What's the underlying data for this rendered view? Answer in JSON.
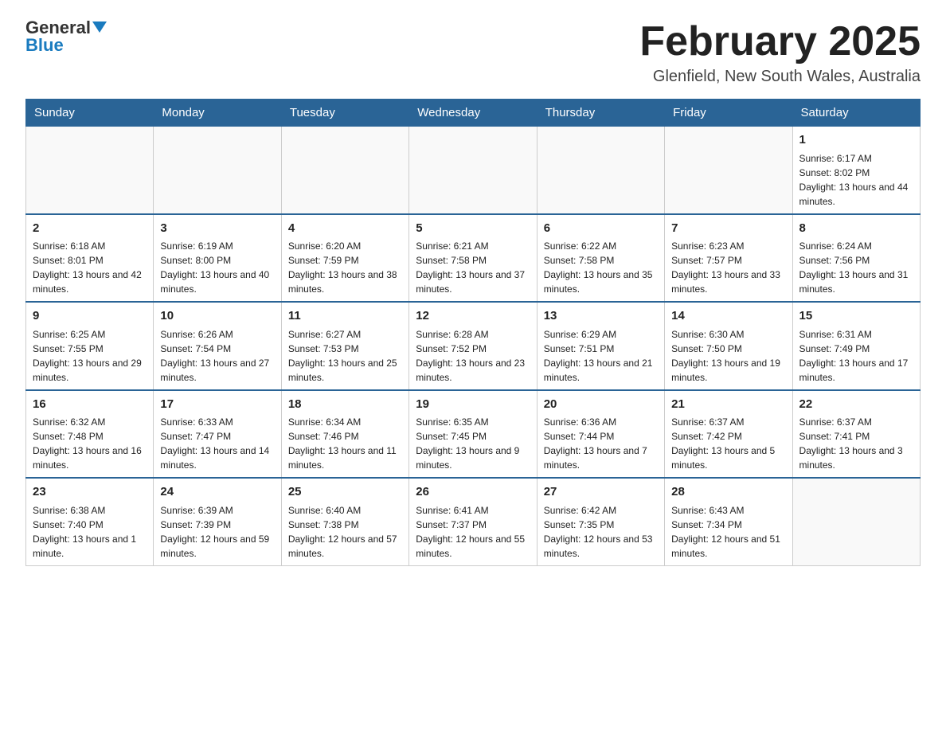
{
  "header": {
    "logo_general": "General",
    "logo_blue": "Blue",
    "month_title": "February 2025",
    "location": "Glenfield, New South Wales, Australia"
  },
  "days_of_week": [
    "Sunday",
    "Monday",
    "Tuesday",
    "Wednesday",
    "Thursday",
    "Friday",
    "Saturday"
  ],
  "weeks": [
    [
      {
        "day": "",
        "info": ""
      },
      {
        "day": "",
        "info": ""
      },
      {
        "day": "",
        "info": ""
      },
      {
        "day": "",
        "info": ""
      },
      {
        "day": "",
        "info": ""
      },
      {
        "day": "",
        "info": ""
      },
      {
        "day": "1",
        "info": "Sunrise: 6:17 AM\nSunset: 8:02 PM\nDaylight: 13 hours and 44 minutes."
      }
    ],
    [
      {
        "day": "2",
        "info": "Sunrise: 6:18 AM\nSunset: 8:01 PM\nDaylight: 13 hours and 42 minutes."
      },
      {
        "day": "3",
        "info": "Sunrise: 6:19 AM\nSunset: 8:00 PM\nDaylight: 13 hours and 40 minutes."
      },
      {
        "day": "4",
        "info": "Sunrise: 6:20 AM\nSunset: 7:59 PM\nDaylight: 13 hours and 38 minutes."
      },
      {
        "day": "5",
        "info": "Sunrise: 6:21 AM\nSunset: 7:58 PM\nDaylight: 13 hours and 37 minutes."
      },
      {
        "day": "6",
        "info": "Sunrise: 6:22 AM\nSunset: 7:58 PM\nDaylight: 13 hours and 35 minutes."
      },
      {
        "day": "7",
        "info": "Sunrise: 6:23 AM\nSunset: 7:57 PM\nDaylight: 13 hours and 33 minutes."
      },
      {
        "day": "8",
        "info": "Sunrise: 6:24 AM\nSunset: 7:56 PM\nDaylight: 13 hours and 31 minutes."
      }
    ],
    [
      {
        "day": "9",
        "info": "Sunrise: 6:25 AM\nSunset: 7:55 PM\nDaylight: 13 hours and 29 minutes."
      },
      {
        "day": "10",
        "info": "Sunrise: 6:26 AM\nSunset: 7:54 PM\nDaylight: 13 hours and 27 minutes."
      },
      {
        "day": "11",
        "info": "Sunrise: 6:27 AM\nSunset: 7:53 PM\nDaylight: 13 hours and 25 minutes."
      },
      {
        "day": "12",
        "info": "Sunrise: 6:28 AM\nSunset: 7:52 PM\nDaylight: 13 hours and 23 minutes."
      },
      {
        "day": "13",
        "info": "Sunrise: 6:29 AM\nSunset: 7:51 PM\nDaylight: 13 hours and 21 minutes."
      },
      {
        "day": "14",
        "info": "Sunrise: 6:30 AM\nSunset: 7:50 PM\nDaylight: 13 hours and 19 minutes."
      },
      {
        "day": "15",
        "info": "Sunrise: 6:31 AM\nSunset: 7:49 PM\nDaylight: 13 hours and 17 minutes."
      }
    ],
    [
      {
        "day": "16",
        "info": "Sunrise: 6:32 AM\nSunset: 7:48 PM\nDaylight: 13 hours and 16 minutes."
      },
      {
        "day": "17",
        "info": "Sunrise: 6:33 AM\nSunset: 7:47 PM\nDaylight: 13 hours and 14 minutes."
      },
      {
        "day": "18",
        "info": "Sunrise: 6:34 AM\nSunset: 7:46 PM\nDaylight: 13 hours and 11 minutes."
      },
      {
        "day": "19",
        "info": "Sunrise: 6:35 AM\nSunset: 7:45 PM\nDaylight: 13 hours and 9 minutes."
      },
      {
        "day": "20",
        "info": "Sunrise: 6:36 AM\nSunset: 7:44 PM\nDaylight: 13 hours and 7 minutes."
      },
      {
        "day": "21",
        "info": "Sunrise: 6:37 AM\nSunset: 7:42 PM\nDaylight: 13 hours and 5 minutes."
      },
      {
        "day": "22",
        "info": "Sunrise: 6:37 AM\nSunset: 7:41 PM\nDaylight: 13 hours and 3 minutes."
      }
    ],
    [
      {
        "day": "23",
        "info": "Sunrise: 6:38 AM\nSunset: 7:40 PM\nDaylight: 13 hours and 1 minute."
      },
      {
        "day": "24",
        "info": "Sunrise: 6:39 AM\nSunset: 7:39 PM\nDaylight: 12 hours and 59 minutes."
      },
      {
        "day": "25",
        "info": "Sunrise: 6:40 AM\nSunset: 7:38 PM\nDaylight: 12 hours and 57 minutes."
      },
      {
        "day": "26",
        "info": "Sunrise: 6:41 AM\nSunset: 7:37 PM\nDaylight: 12 hours and 55 minutes."
      },
      {
        "day": "27",
        "info": "Sunrise: 6:42 AM\nSunset: 7:35 PM\nDaylight: 12 hours and 53 minutes."
      },
      {
        "day": "28",
        "info": "Sunrise: 6:43 AM\nSunset: 7:34 PM\nDaylight: 12 hours and 51 minutes."
      },
      {
        "day": "",
        "info": ""
      }
    ]
  ]
}
